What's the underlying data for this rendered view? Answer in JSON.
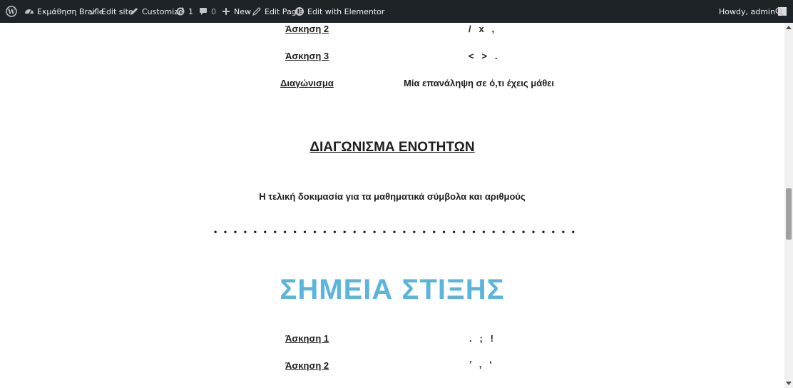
{
  "adminbar": {
    "site_name": "Εκμάθηση Braille",
    "edit_site": "Edit site",
    "customize": "Customize",
    "updates_count": "1",
    "comments_count": "0",
    "new": "New",
    "edit_page": "Edit Page",
    "edit_with_elementor": "Edit with Elementor",
    "howdy": "Howdy, admin"
  },
  "content": {
    "rows_top": [
      {
        "link": "Άσκηση 2",
        "symbols": "/   x   ,"
      },
      {
        "link": "Άσκηση 3",
        "symbols": "<   >   ."
      },
      {
        "link": "Διαγώνισμα",
        "symbols": "Μία επανάληψη σε ό,τι έχεις μάθει"
      }
    ],
    "section_heading": "ΔΙΑΓΩΝΙΣΜΑ ΕΝΟΤΗΤΩΝ",
    "section_text": "Η τελική δοκιμασία για τα μαθηματικά σύμβολα και αριθμούς",
    "separator": "• • • • • • • • • • • • • • • • • • • • • • • • • • • • • • • • • • • • • • • • • • • • • • • • • • • • • • • • • • • • • • • • • • • • • • • • • • • • •",
    "big_title": "ΣΗΜΕΙΑ ΣΤΙΞΗΣ",
    "rows_bottom": [
      {
        "link": "Άσκηση 1",
        "symbols": ".   ;   !"
      },
      {
        "link": "Άσκηση 2",
        "symbols": "’   ,   ‘"
      }
    ]
  }
}
